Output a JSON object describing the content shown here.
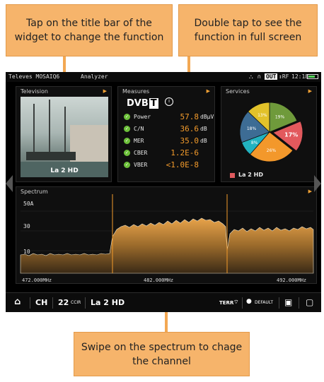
{
  "callouts": {
    "top_left": "Tap on the title bar of the widget to change the function",
    "top_right": "Double tap to see the function in full screen",
    "bottom": "Swipe on the spectrum to chage the channel"
  },
  "status_bar": {
    "brand": "Televes MOSAIQ6",
    "app": "Analyzer",
    "out_badge": "OUT",
    "rf_label": "↕RF",
    "time": "12:18"
  },
  "television": {
    "title": "Television",
    "channel_label": "La 2 HD"
  },
  "measures": {
    "title": "Measures",
    "standard": "DVB-T",
    "rows": [
      {
        "name": "Power",
        "value": "57.8",
        "unit": "dBμV"
      },
      {
        "name": "C/N",
        "value": "36.6",
        "unit": "dB"
      },
      {
        "name": "MER",
        "value": "35.0",
        "unit": "dB"
      },
      {
        "name": "CBER",
        "value": "1.2E-6",
        "unit": ""
      },
      {
        "name": "VBER",
        "value": "<1.0E-8",
        "unit": ""
      }
    ]
  },
  "services": {
    "title": "Services",
    "legend": "La 2 HD",
    "pie": [
      {
        "label": "19%",
        "value": 19,
        "color": "#6f9a3b"
      },
      {
        "label": "17%",
        "value": 17,
        "color": "#e2595d"
      },
      {
        "label": "26%",
        "value": 26,
        "color": "#f3982b"
      },
      {
        "label": "8%",
        "value": 8,
        "color": "#22b2c0"
      },
      {
        "label": "18%",
        "value": 18,
        "color": "#3d6c94"
      },
      {
        "label": "13%",
        "value": 13,
        "color": "#e2c22a"
      }
    ]
  },
  "spectrum": {
    "title": "Spectrum",
    "y_ticks": [
      "50A",
      "30",
      "10"
    ],
    "freq_left": "472.000MHz",
    "freq_mid": "482.000MHz",
    "freq_right": "492.000MHz"
  },
  "bottom_bar": {
    "ch_label": "CH",
    "channel_number": "22",
    "plan": "CCIR",
    "channel_name": "La 2 HD",
    "terr": "TERR",
    "profile": "DEFAULT"
  },
  "colors": {
    "accent": "#f39b2b",
    "callout": "#f6b46b",
    "ok": "#6dc13a"
  }
}
